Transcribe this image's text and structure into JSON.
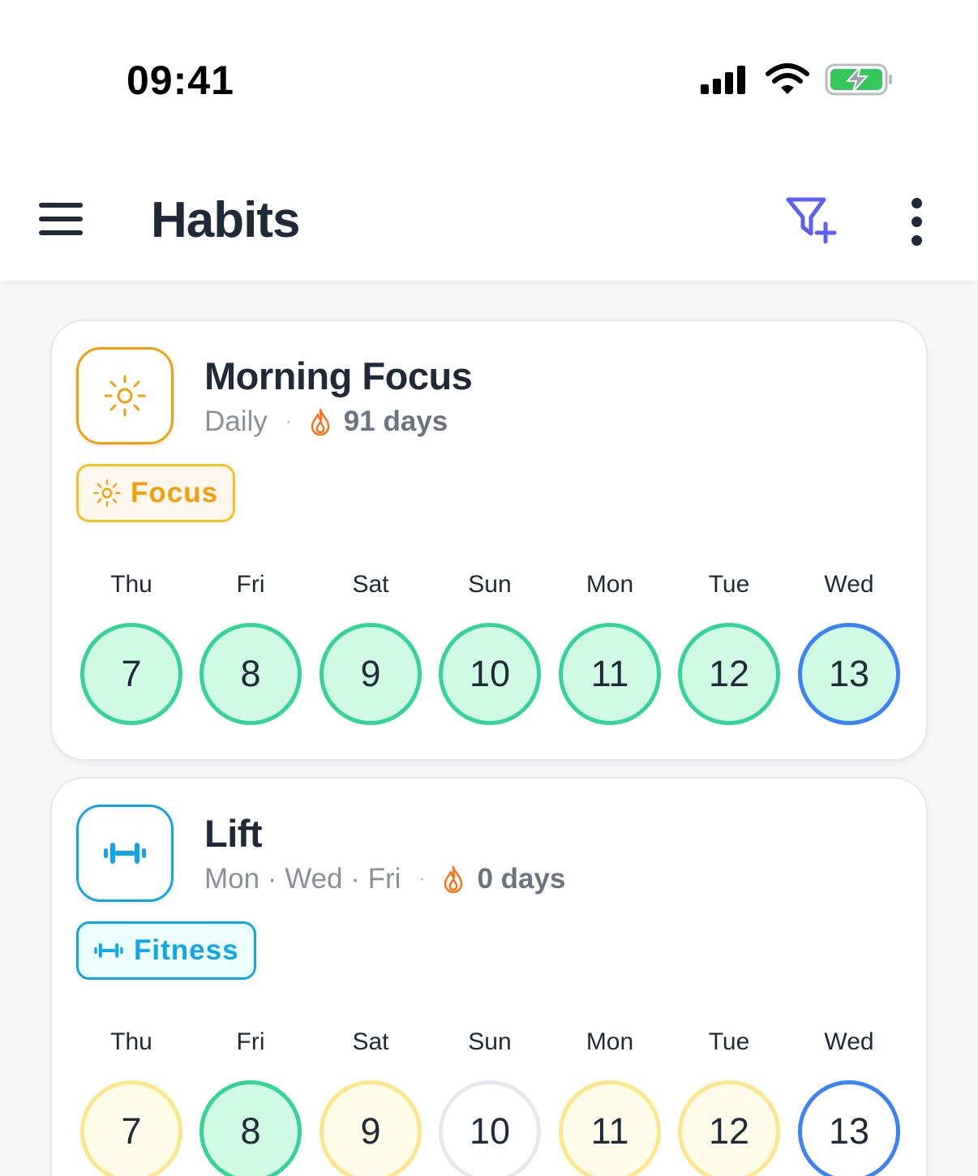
{
  "status_bar": {
    "time": "09:41"
  },
  "app_bar": {
    "title": "Habits"
  },
  "colors": {
    "accent": "#5b5ff2",
    "done": "#34d399",
    "partial": "#fde68a",
    "today": "#3b82f6"
  },
  "habits": [
    {
      "name": "Morning Focus",
      "schedule": "Daily",
      "separator": "·",
      "streak": "91 days",
      "icon": "sun-icon",
      "color": "#f59e0b",
      "tag": {
        "label": "Focus",
        "icon": "sun-icon"
      },
      "days": [
        {
          "label": "Thu",
          "date": "7",
          "status": "done"
        },
        {
          "label": "Fri",
          "date": "8",
          "status": "done"
        },
        {
          "label": "Sat",
          "date": "9",
          "status": "done"
        },
        {
          "label": "Sun",
          "date": "10",
          "status": "done"
        },
        {
          "label": "Mon",
          "date": "11",
          "status": "done"
        },
        {
          "label": "Tue",
          "date": "12",
          "status": "done"
        },
        {
          "label": "Wed",
          "date": "13",
          "status": "done-today"
        }
      ]
    },
    {
      "name": "Lift",
      "schedule": "Mon · Wed · Fri",
      "separator": "·",
      "streak": "0 days",
      "icon": "dumbbell-icon",
      "color": "#0ea5e9",
      "tag": {
        "label": "Fitness",
        "icon": "dumbbell-icon"
      },
      "days": [
        {
          "label": "Thu",
          "date": "7",
          "status": "partial"
        },
        {
          "label": "Fri",
          "date": "8",
          "status": "done"
        },
        {
          "label": "Sat",
          "date": "9",
          "status": "partial"
        },
        {
          "label": "Sun",
          "date": "10",
          "status": "empty"
        },
        {
          "label": "Mon",
          "date": "11",
          "status": "partial"
        },
        {
          "label": "Tue",
          "date": "12",
          "status": "partial"
        },
        {
          "label": "Wed",
          "date": "13",
          "status": "today"
        }
      ]
    }
  ]
}
